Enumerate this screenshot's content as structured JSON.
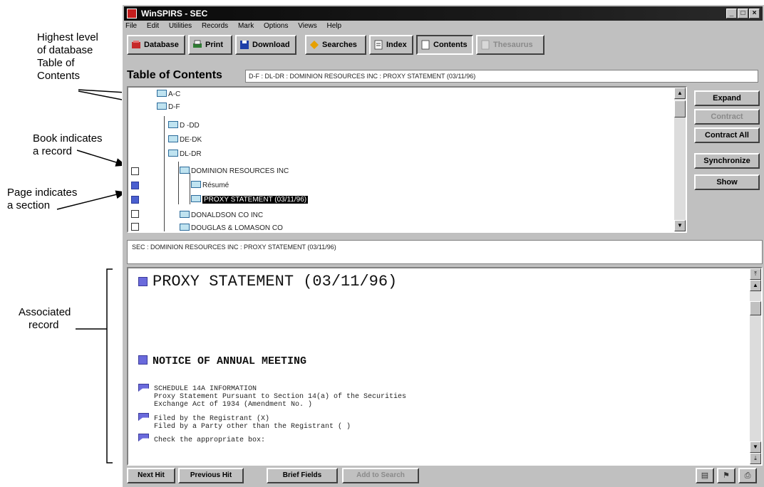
{
  "annotations": {
    "top_level": [
      "Highest level",
      "of database",
      "Table of",
      "Contents"
    ],
    "book": [
      "Book indicates",
      "a record"
    ],
    "page": [
      "Page indicates",
      "a section"
    ],
    "associated": [
      "Associated",
      "record"
    ]
  },
  "window": {
    "title": "WinSPIRS - SEC",
    "controls": [
      "_",
      "□",
      "×"
    ]
  },
  "menu": [
    "File",
    "Edit",
    "Utilities",
    "Records",
    "Mark",
    "Options",
    "Views",
    "Help"
  ],
  "toolbar": {
    "database": "Database",
    "print": "Print",
    "download": "Download",
    "searches": "Searches",
    "index": "Index",
    "contents": "Contents",
    "thesaurus": "Thesaurus"
  },
  "toc": {
    "title": "Table of Contents",
    "path": "D-F : DL-DR : DOMINION RESOURCES INC : PROXY STATEMENT (03/11/96)",
    "rows": [
      "A-C",
      "D-F",
      "D -DD",
      "DE-DK",
      "DL-DR",
      "DOMINION RESOURCES INC",
      "Résumé",
      "PROXY STATEMENT (03/11/96)",
      "DONALDSON CO INC",
      "DOUGLAS & LOMASON CO"
    ]
  },
  "side_buttons": {
    "expand": "Expand",
    "contract": "Contract",
    "contract_all": "Contract All",
    "synchronize": "Synchronize",
    "show": "Show"
  },
  "status_path": "SEC : DOMINION RESOURCES INC : PROXY STATEMENT (03/11/96)",
  "document": {
    "heading": "PROXY STATEMENT (03/11/96)",
    "subheading": "NOTICE OF ANNUAL MEETING",
    "para1": [
      "SCHEDULE 14A INFORMATION",
      "Proxy Statement Pursuant to Section 14(a) of the Securities",
      "Exchange Act of 1934 (Amendment No. )"
    ],
    "para2": [
      "Filed by the Registrant (X)",
      "Filed by a Party other than the Registrant ( )"
    ],
    "para3": [
      "Check the appropriate box:"
    ]
  },
  "bottom": {
    "next_hit": "Next Hit",
    "previous_hit": "Previous Hit",
    "brief_fields": "Brief Fields",
    "add_to_search": "Add to Search"
  }
}
